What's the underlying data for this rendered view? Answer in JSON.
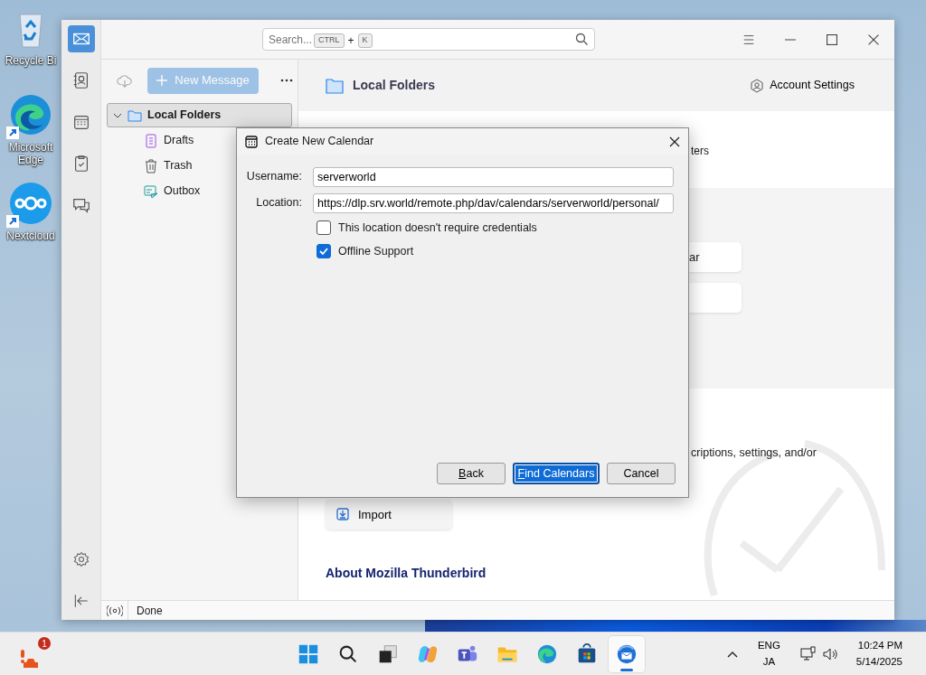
{
  "desktop_icons": [
    {
      "kind": "recycle",
      "label": "Recycle Bi",
      "shortcut": false
    },
    {
      "kind": "edge",
      "label": "Microsoft Edge",
      "shortcut": true
    },
    {
      "kind": "nextcloud",
      "label": "Nextcloud",
      "shortcut": true
    }
  ],
  "window": {
    "search": {
      "placeholder": "Search...",
      "keys": [
        "CTRL",
        "K"
      ],
      "joiner": "+"
    },
    "rail": [
      {
        "kind": "mail",
        "selected": true
      },
      {
        "kind": "addressbook",
        "selected": false
      },
      {
        "kind": "calendar",
        "selected": false
      },
      {
        "kind": "tasks",
        "selected": false
      },
      {
        "kind": "chat",
        "selected": false
      }
    ],
    "new_message": {
      "label": "New Message",
      "disabled": true
    },
    "folders": [
      {
        "kind": "account",
        "label": "Local Folders",
        "expanded": true,
        "selected": true,
        "children": [
          {
            "kind": "drafts",
            "label": "Drafts",
            "selected": false
          },
          {
            "kind": "trash",
            "label": "Trash",
            "selected": false
          },
          {
            "kind": "outbox",
            "label": "Outbox",
            "selected": false
          }
        ]
      }
    ],
    "main": {
      "title": "Local Folders",
      "account_settings": "Account Settings",
      "intro_fragment": "ters",
      "card_fragment": "ar",
      "description_fragment": "criptions, settings, and/or",
      "import_button": "Import",
      "about_heading": "About Mozilla Thunderbird"
    },
    "status_bar": {
      "text": "Done"
    }
  },
  "dialog": {
    "title": "Create New Calendar",
    "fields": [
      {
        "label": "Username:",
        "value": "serverworld"
      },
      {
        "label": "Location:",
        "value": "https://dlp.srv.world/remote.php/dav/calendars/serverworld/personal/"
      }
    ],
    "checkboxes": [
      {
        "label": "This location doesn't require credentials",
        "checked": false
      },
      {
        "label": "Offline Support",
        "checked": true
      }
    ],
    "buttons": [
      {
        "label": "Back",
        "default": false,
        "access_key": true
      },
      {
        "label": "Find Calendars",
        "default": true,
        "access_key": true
      },
      {
        "label": "Cancel",
        "default": false,
        "access_key": false
      }
    ]
  },
  "taskbar": {
    "notification_count": "1",
    "apps": [
      {
        "kind": "start",
        "active": false
      },
      {
        "kind": "search",
        "active": false
      },
      {
        "kind": "taskview",
        "active": false
      },
      {
        "kind": "copilot",
        "active": false
      },
      {
        "kind": "teams",
        "active": false
      },
      {
        "kind": "explorer",
        "active": false
      },
      {
        "kind": "edge",
        "active": false
      },
      {
        "kind": "store",
        "active": false
      },
      {
        "kind": "thunderbird",
        "active": true
      }
    ],
    "language": [
      "ENG",
      "JA"
    ],
    "time": "10:24 PM",
    "date": "5/14/2025"
  }
}
